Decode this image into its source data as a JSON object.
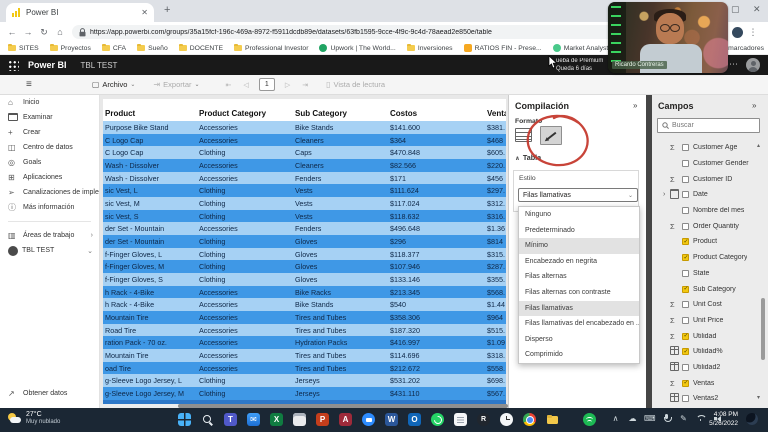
{
  "browser": {
    "tab_title": "Power BI",
    "url": "https://app.powerbi.com/groups/35a15fcf-196c-469a-8972-f5911dcdb89e/datasets/63fb1595-9cce-4f9c-9c4d-78aead2e850e/table",
    "other_bookmarks": "ros marcadores",
    "bookmarks": [
      {
        "label": "SITES",
        "icon": "folder"
      },
      {
        "label": "Proyectos",
        "icon": "folder"
      },
      {
        "label": "CFA",
        "icon": "folder"
      },
      {
        "label": "Sueño",
        "icon": "folder"
      },
      {
        "label": "DOCENTE",
        "icon": "folder"
      },
      {
        "label": "Professional Investor",
        "icon": "folder"
      },
      {
        "label": "Upwork | The World...",
        "icon": "green"
      },
      {
        "label": "Inversiones",
        "icon": "folder"
      },
      {
        "label": "RATIOS FIN - Prese...",
        "icon": "orange"
      },
      {
        "label": "Market Analyst | eT...",
        "icon": "owl"
      },
      {
        "label": "Procharts",
        "icon": "owl"
      },
      {
        "label": "",
        "icon": "purple"
      }
    ]
  },
  "appbar": {
    "brand": "Power BI",
    "workspace": "TBL TEST",
    "trial_line1": "ueba de Premium",
    "trial_line2": "Queda 6 días"
  },
  "toolbar": {
    "file": "Archivo",
    "export": "Exportar",
    "page": "1",
    "reading_view": "Vista de lectura"
  },
  "sidebar": {
    "items": [
      {
        "label": "Inicio",
        "icon": "home"
      },
      {
        "label": "Examinar",
        "icon": "browse"
      },
      {
        "label": "Crear",
        "icon": "create"
      },
      {
        "label": "Centro de datos",
        "icon": "datahub"
      },
      {
        "label": "Goals",
        "icon": "goals"
      },
      {
        "label": "Aplicaciones",
        "icon": "apps"
      },
      {
        "label": "Canalizaciones de implem...",
        "icon": "pipeline"
      },
      {
        "label": "Más información",
        "icon": "info"
      }
    ],
    "workspaces_label": "Áreas de trabajo",
    "current_workspace": "TBL TEST",
    "get_data": "Obtener datos"
  },
  "table": {
    "headers": [
      "Product",
      "Product Category",
      "Sub Category",
      "Costos",
      "Ventas"
    ],
    "rows": [
      {
        "product": "Purpose Bike Stand",
        "category": "Accessories",
        "sub": "Bike Stands",
        "costos": "$141.600",
        "ventas": "$381."
      },
      {
        "product": "C Logo Cap",
        "category": "Accessories",
        "sub": "Cleaners",
        "costos": "$364",
        "ventas": "$468"
      },
      {
        "product": "C Logo Cap",
        "category": "Clothing",
        "sub": "Caps",
        "costos": "$470.848",
        "ventas": "$605."
      },
      {
        "product": "Wash - Dissolver",
        "category": "Accessories",
        "sub": "Cleaners",
        "costos": "$82.566",
        "ventas": "$220."
      },
      {
        "product": "Wash - Dissolver",
        "category": "Accessories",
        "sub": "Fenders",
        "costos": "$171",
        "ventas": "$456"
      },
      {
        "product": "sic Vest, L",
        "category": "Clothing",
        "sub": "Vests",
        "costos": "$111.624",
        "ventas": "$297."
      },
      {
        "product": "sic Vest, M",
        "category": "Clothing",
        "sub": "Vests",
        "costos": "$117.024",
        "ventas": "$312."
      },
      {
        "product": "sic Vest, S",
        "category": "Clothing",
        "sub": "Vests",
        "costos": "$118.632",
        "ventas": "$316."
      },
      {
        "product": "der Set - Mountain",
        "category": "Accessories",
        "sub": "Fenders",
        "costos": "$496.648",
        "ventas": "$1.36"
      },
      {
        "product": "der Set - Mountain",
        "category": "Clothing",
        "sub": "Gloves",
        "costos": "$296",
        "ventas": "$814"
      },
      {
        "product": "f-Finger Gloves, L",
        "category": "Clothing",
        "sub": "Gloves",
        "costos": "$118.377",
        "ventas": "$315."
      },
      {
        "product": "f-Finger Gloves, M",
        "category": "Clothing",
        "sub": "Gloves",
        "costos": "$107.946",
        "ventas": "$287."
      },
      {
        "product": "f-Finger Gloves, S",
        "category": "Clothing",
        "sub": "Gloves",
        "costos": "$133.146",
        "ventas": "$355."
      },
      {
        "product": "h Rack - 4-Bike",
        "category": "Accessories",
        "sub": "Bike Racks",
        "costos": "$213.345",
        "ventas": "$568."
      },
      {
        "product": "h Rack - 4-Bike",
        "category": "Accessories",
        "sub": "Bike Stands",
        "costos": "$540",
        "ventas": "$1.44"
      },
      {
        "product": "Mountain Tire",
        "category": "Accessories",
        "sub": "Tires and Tubes",
        "costos": "$358.306",
        "ventas": "$964"
      },
      {
        "product": "Road Tire",
        "category": "Accessories",
        "sub": "Tires and Tubes",
        "costos": "$187.320",
        "ventas": "$515."
      },
      {
        "product": "ration Pack - 70 oz.",
        "category": "Accessories",
        "sub": "Hydration Packs",
        "costos": "$416.997",
        "ventas": "$1.09"
      },
      {
        "product": "Mountain Tire",
        "category": "Accessories",
        "sub": "Tires and Tubes",
        "costos": "$114.696",
        "ventas": "$318."
      },
      {
        "product": "oad Tire",
        "category": "Accessories",
        "sub": "Tires and Tubes",
        "costos": "$212.672",
        "ventas": "$558."
      },
      {
        "product": "g-Sleeve Logo Jersey, L",
        "category": "Clothing",
        "sub": "Jerseys",
        "costos": "$531.202",
        "ventas": "$698."
      },
      {
        "product": "g-Sleeve Logo Jersey, M",
        "category": "Clothing",
        "sub": "Jerseys",
        "costos": "$431.110",
        "ventas": "$567."
      }
    ]
  },
  "format_panel": {
    "title": "Compilación",
    "format_label": "Formato",
    "section": "Tabla",
    "style_label": "Estilo",
    "style_value": "Filas llamativas",
    "options": [
      {
        "label": "Ninguno"
      },
      {
        "label": "Predeterminado"
      },
      {
        "label": "Mínimo",
        "hl": true
      },
      {
        "label": "Encabezado en negrita"
      },
      {
        "label": "Filas alternas"
      },
      {
        "label": "Filas alternas con contraste"
      },
      {
        "label": "Filas llamativas",
        "hl": true
      },
      {
        "label": "Filas llamativas del encabezado en ..."
      },
      {
        "label": "Disperso"
      },
      {
        "label": "Comprimido"
      }
    ]
  },
  "fields_panel": {
    "title": "Campos",
    "search_placeholder": "Buscar",
    "fields": [
      {
        "label": "Customer Age",
        "icon": "sigma"
      },
      {
        "label": "Customer Gender",
        "icon": "none"
      },
      {
        "label": "Customer ID",
        "icon": "sigma"
      },
      {
        "label": "Date",
        "icon": "cal",
        "expand": true
      },
      {
        "label": "Nombre del mes",
        "icon": "none"
      },
      {
        "label": "Order Quantity",
        "icon": "sigma"
      },
      {
        "label": "Product",
        "icon": "none",
        "checked": true
      },
      {
        "label": "Product Category",
        "icon": "none",
        "checked": true
      },
      {
        "label": "State",
        "icon": "none"
      },
      {
        "label": "Sub Category",
        "icon": "none",
        "checked": true
      },
      {
        "label": "Unit Cost",
        "icon": "sigma"
      },
      {
        "label": "Unit Price",
        "icon": "sigma"
      },
      {
        "label": "Utilidad",
        "icon": "sigma",
        "checked": true
      },
      {
        "label": "Utilidad%",
        "icon": "calc",
        "checked": true
      },
      {
        "label": "Utilidad2",
        "icon": "calc"
      },
      {
        "label": "Ventas",
        "icon": "sigma",
        "checked": true
      },
      {
        "label": "Ventas2",
        "icon": "calc"
      }
    ]
  },
  "webcam": {
    "name": "Ricardo Contreras"
  },
  "taskbar": {
    "temp": "27°C",
    "weather": "Muy nublado",
    "time": "4:08 PM",
    "date": "5/26/2022",
    "icons": [
      {
        "name": "start"
      },
      {
        "name": "search"
      },
      {
        "name": "teams"
      },
      {
        "name": "mail"
      },
      {
        "name": "excel"
      },
      {
        "name": "calculator"
      },
      {
        "name": "powerpoint"
      },
      {
        "name": "access"
      },
      {
        "name": "app-blue"
      },
      {
        "name": "word"
      },
      {
        "name": "outlook"
      },
      {
        "name": "whatsapp"
      },
      {
        "name": "notepad"
      },
      {
        "name": "remote"
      },
      {
        "name": "clock"
      },
      {
        "name": "chrome"
      },
      {
        "name": "file-explorer"
      },
      {
        "name": "spotify"
      }
    ],
    "tray": [
      "chevron-up",
      "onedrive",
      "keyboard",
      "mic",
      "pen",
      "wifi",
      "volume"
    ]
  },
  "colors": {
    "accent_yellow": "#f2c811",
    "row_dark": "#3f98e6",
    "row_light": "#a6d1f4",
    "taskbar": "#1b2734"
  }
}
